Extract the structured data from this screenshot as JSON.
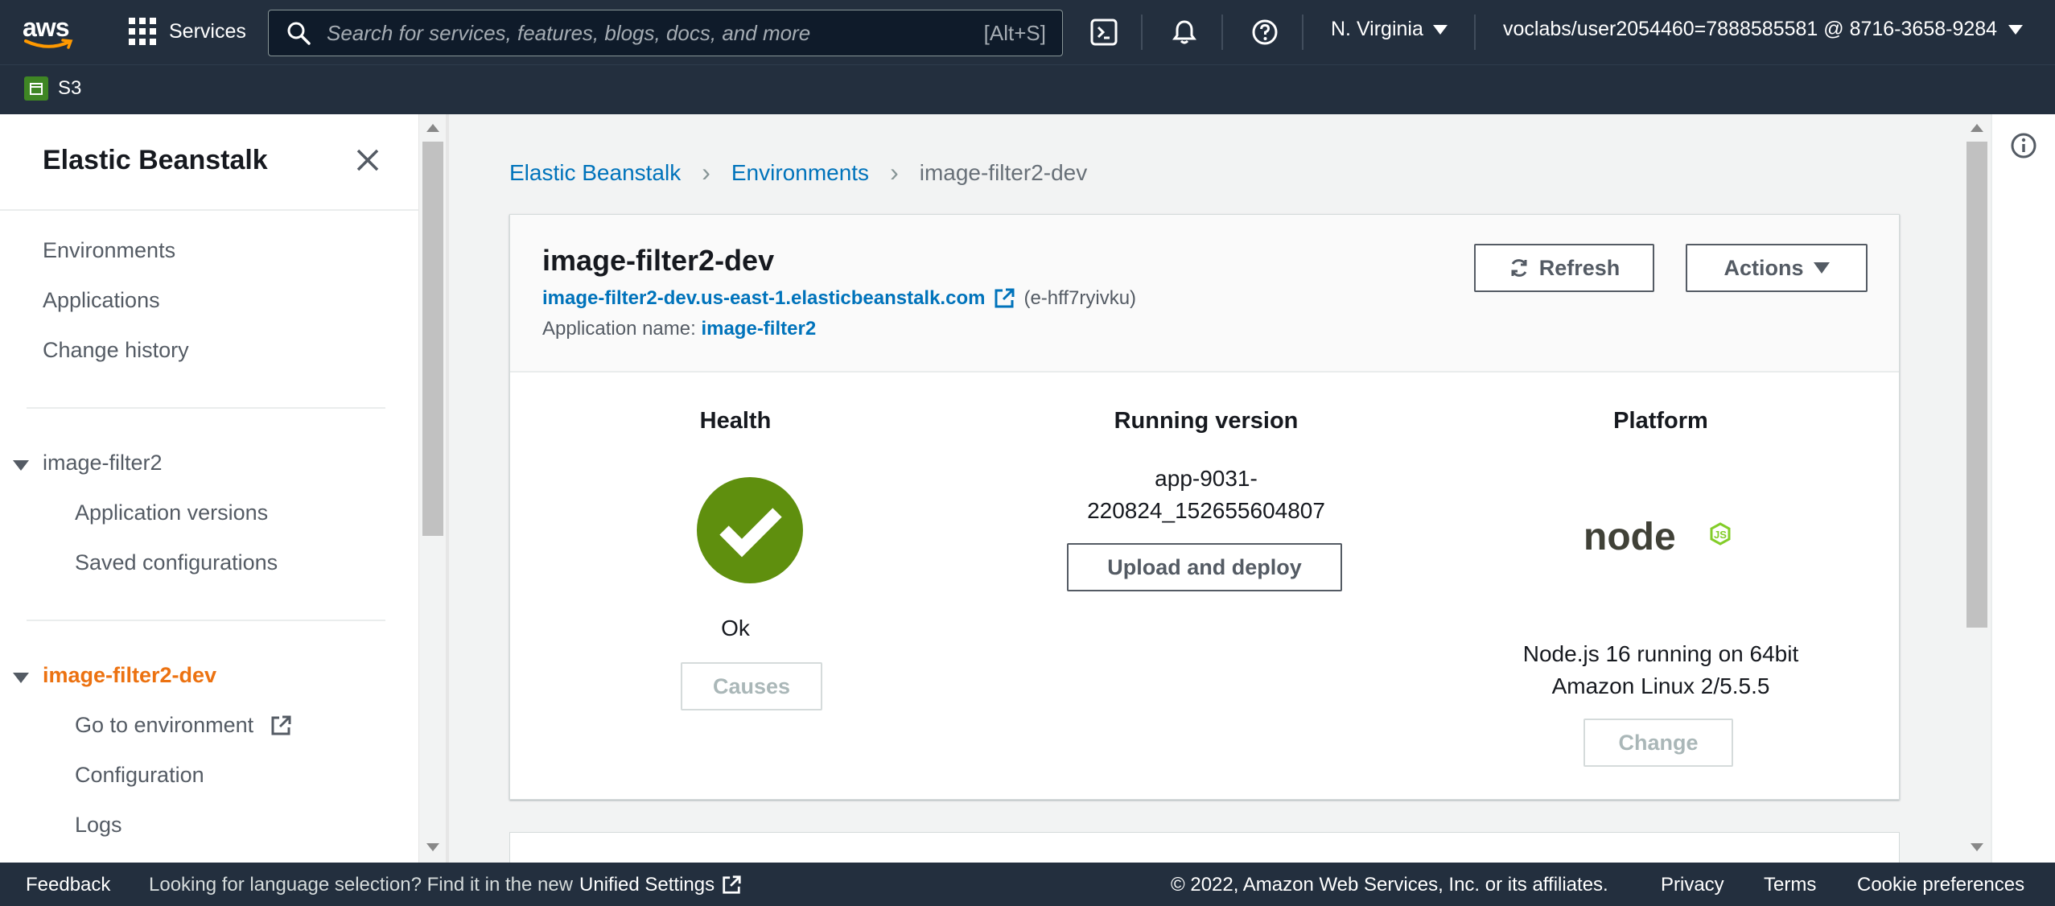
{
  "topnav": {
    "logo_text": "aws",
    "services_label": "Services",
    "search_placeholder": "Search for services, features, blogs, docs, and more",
    "search_shortcut": "[Alt+S]",
    "region": "N. Virginia",
    "account": "voclabs/user2054460=7888585581 @ 8716-3658-9284"
  },
  "subnav": {
    "favorite": "S3"
  },
  "sidebar": {
    "title": "Elastic Beanstalk",
    "top_items": [
      "Environments",
      "Applications",
      "Change history"
    ],
    "app_group": {
      "label": "image-filter2",
      "items": [
        "Application versions",
        "Saved configurations"
      ]
    },
    "env_group": {
      "label": "image-filter2-dev",
      "items": [
        "Go to environment",
        "Configuration",
        "Logs"
      ]
    }
  },
  "breadcrumb": [
    "Elastic Beanstalk",
    "Environments",
    "image-filter2-dev"
  ],
  "environment": {
    "name": "image-filter2-dev",
    "url": "image-filter2-dev.us-east-1.elasticbeanstalk.com",
    "env_id": "(e-hff7ryivku)",
    "app_name_label": "Application name:",
    "app_name": "image-filter2",
    "refresh_label": "Refresh",
    "actions_label": "Actions"
  },
  "health": {
    "title": "Health",
    "status": "Ok",
    "causes_label": "Causes",
    "color": "#5f8f0e"
  },
  "running_version": {
    "title": "Running version",
    "version_line1": "app-9031-",
    "version_line2": "220824_152655604807",
    "upload_label": "Upload and deploy"
  },
  "platform": {
    "title": "Platform",
    "logo_text": "node",
    "desc_line1": "Node.js 16 running on 64bit",
    "desc_line2": "Amazon Linux 2/5.5.5",
    "change_label": "Change"
  },
  "footer": {
    "feedback": "Feedback",
    "lang_prefix": "Looking for language selection? Find it in the new",
    "lang_link": "Unified Settings",
    "copyright": "© 2022, Amazon Web Services, Inc. or its affiliates.",
    "privacy": "Privacy",
    "terms": "Terms",
    "cookies": "Cookie preferences"
  },
  "colors": {
    "nav_bg": "#232f3e",
    "link": "#0073bb",
    "active": "#ec7211"
  }
}
